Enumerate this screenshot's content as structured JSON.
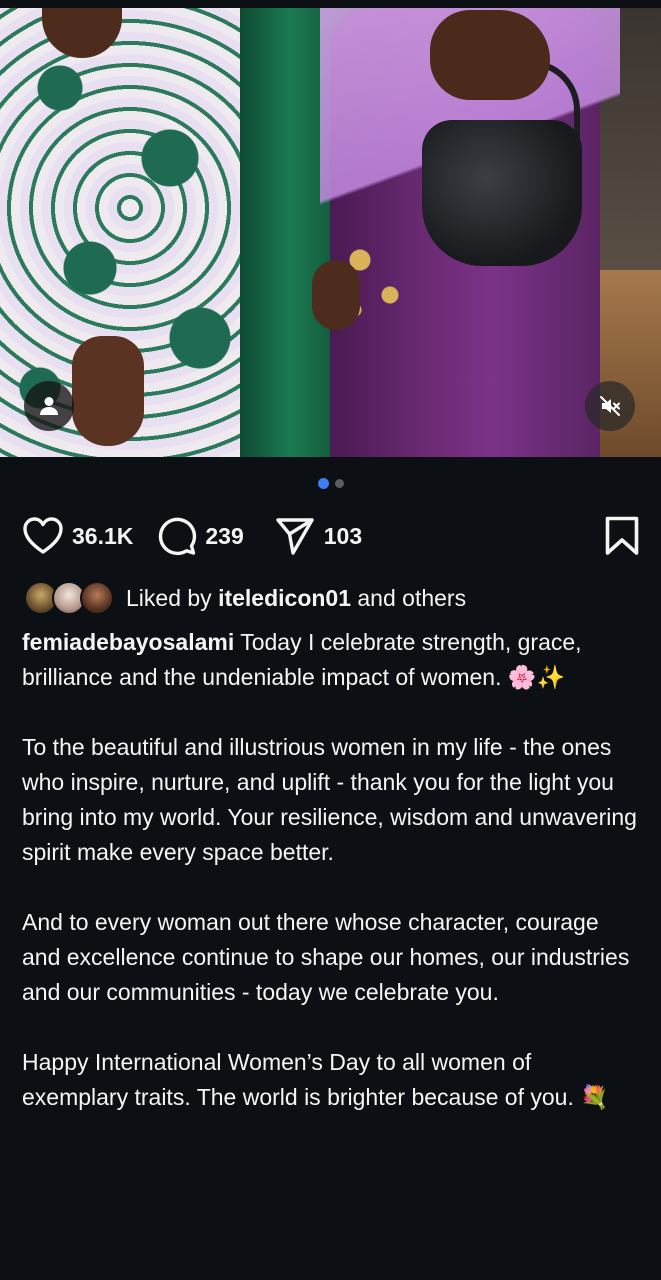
{
  "post": {
    "media": {
      "carousel": {
        "total": 2,
        "active_index": 0
      },
      "user_tag_icon": "person-icon",
      "mute_icon": "speaker-muted-icon"
    },
    "actions": {
      "likes_count": "36.1K",
      "comments_count": "239",
      "shares_count": "103",
      "icons": {
        "like": "heart-outline-icon",
        "comment": "speech-bubble-icon",
        "share": "paper-plane-icon",
        "save": "bookmark-outline-icon"
      }
    },
    "likes": {
      "prefix": "Liked by",
      "user": "iteledicon01",
      "suffix": "and others"
    },
    "caption": {
      "username": "femiadebayosalami",
      "paragraph_1": "Today I celebrate strength, grace, brilliance and the undeniable impact of women. 🌸✨",
      "paragraph_2": "To the beautiful and illustrious women in my life - the ones who inspire, nurture, and uplift - thank you for the light you bring into my world. Your resilience, wisdom and unwavering spirit make every space better.",
      "paragraph_3": "And to every woman out there whose character, courage and excellence continue to shape our homes, our industries and our communities - today we celebrate you.",
      "paragraph_4": "Happy International Women’s Day to all women of exemplary traits. The world is brighter because of you. 💐"
    },
    "colors": {
      "background": "#0c1014",
      "text": "#f5f5f5",
      "active_dot": "#3f7cf5",
      "inactive_dot": "#5a5e63"
    }
  }
}
